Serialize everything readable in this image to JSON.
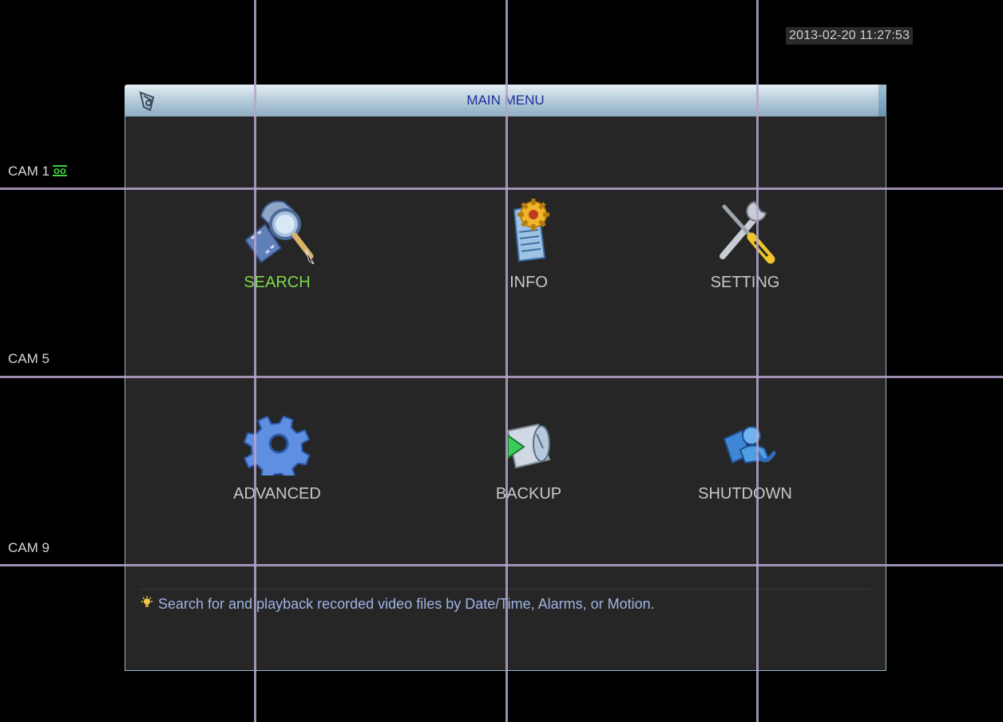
{
  "datetime": "2013-02-20 11:27:53",
  "cameras": {
    "cam1": "CAM 1",
    "cam5": "CAM 5",
    "cam9": "CAM 9",
    "rec_indicator": "oo"
  },
  "menu": {
    "title": "MAIN MENU",
    "items": [
      {
        "label": "SEARCH",
        "icon": "search-icon",
        "selected": true
      },
      {
        "label": "INFO",
        "icon": "info-icon",
        "selected": false
      },
      {
        "label": "SETTING",
        "icon": "setting-icon",
        "selected": false
      },
      {
        "label": "ADVANCED",
        "icon": "advanced-gear-icon",
        "selected": false
      },
      {
        "label": "BACKUP",
        "icon": "backup-icon",
        "selected": false
      },
      {
        "label": "SHUTDOWN",
        "icon": "shutdown-icon",
        "selected": false
      }
    ],
    "hint": "Search for and playback recorded video files by Date/Time, Alarms, or Motion."
  },
  "colors": {
    "selected_label": "#7bd94a",
    "label": "#c8c8c8",
    "title": "#1c2f9a",
    "grid_line": "#b7a4cf"
  }
}
